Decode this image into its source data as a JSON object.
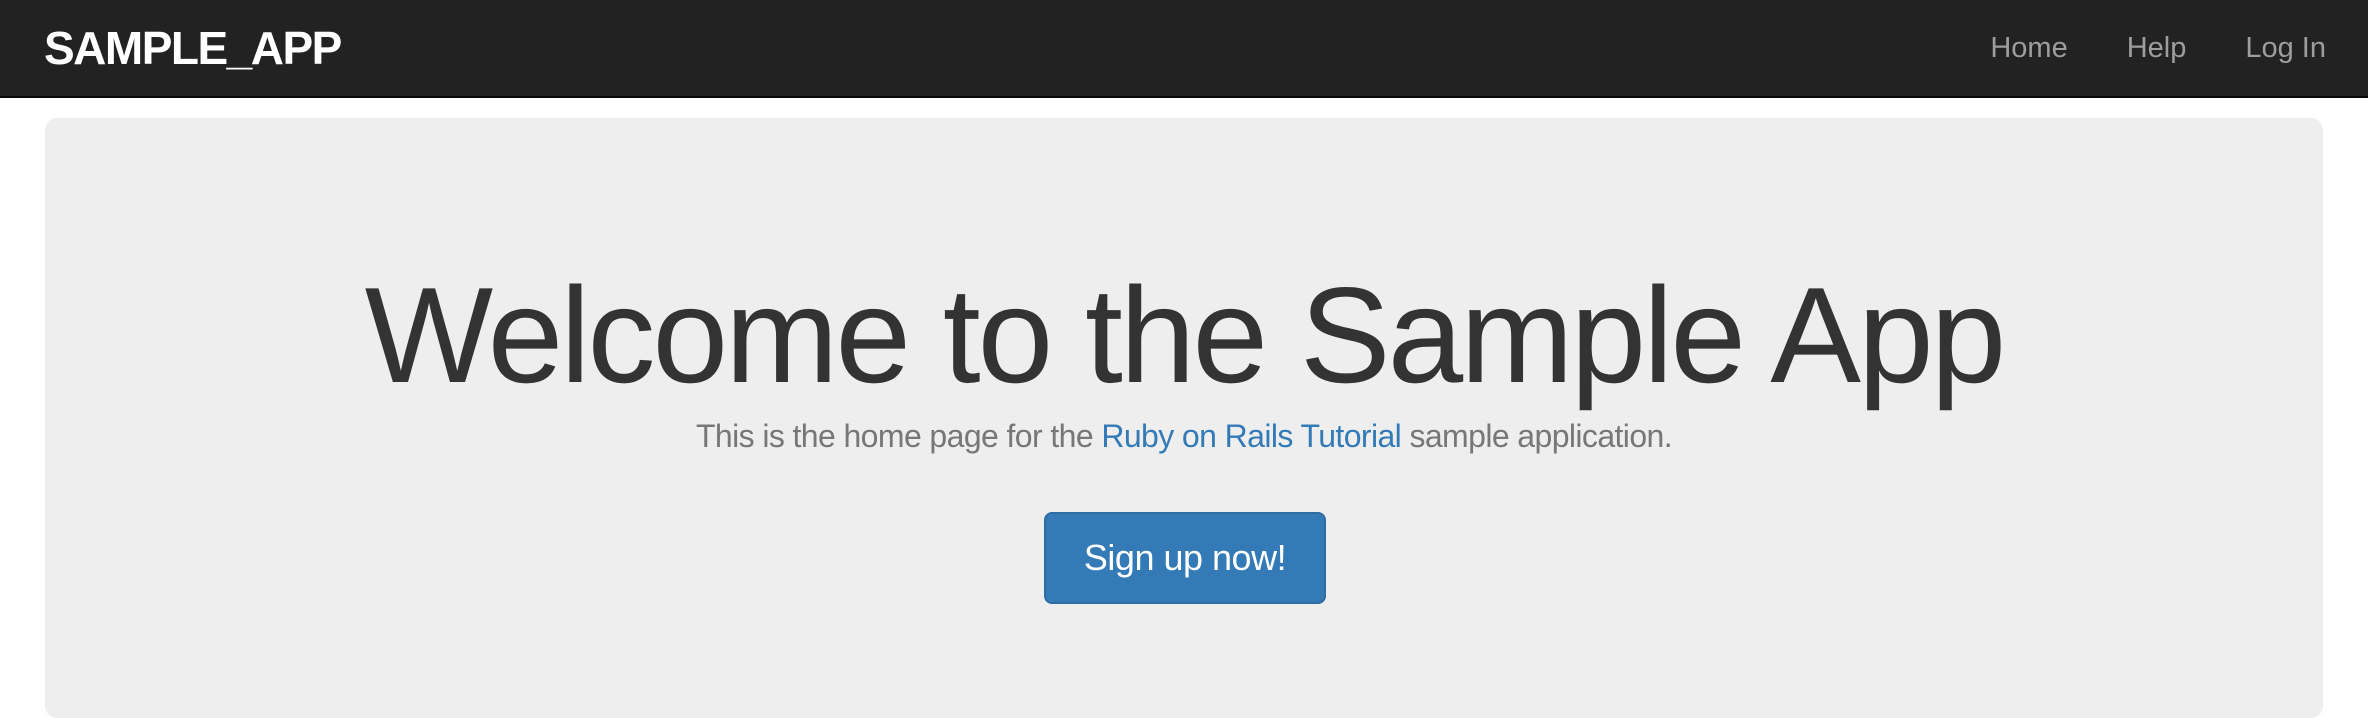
{
  "navbar": {
    "brand": "SAMPLE_APP",
    "links": [
      {
        "label": "Home"
      },
      {
        "label": "Help"
      },
      {
        "label": "Log In"
      }
    ]
  },
  "jumbotron": {
    "headline": "Welcome to the Sample App",
    "tagline_before": "This is the home page for the ",
    "tagline_link": "Ruby on Rails Tutorial",
    "tagline_after": " sample application.",
    "signup_label": "Sign up now!"
  },
  "colors": {
    "navbar_bg": "#222222",
    "nav_link": "#9d9d9d",
    "jumbotron_bg": "#eeeeee",
    "link": "#337ab7",
    "primary_button": "#337ab7"
  }
}
